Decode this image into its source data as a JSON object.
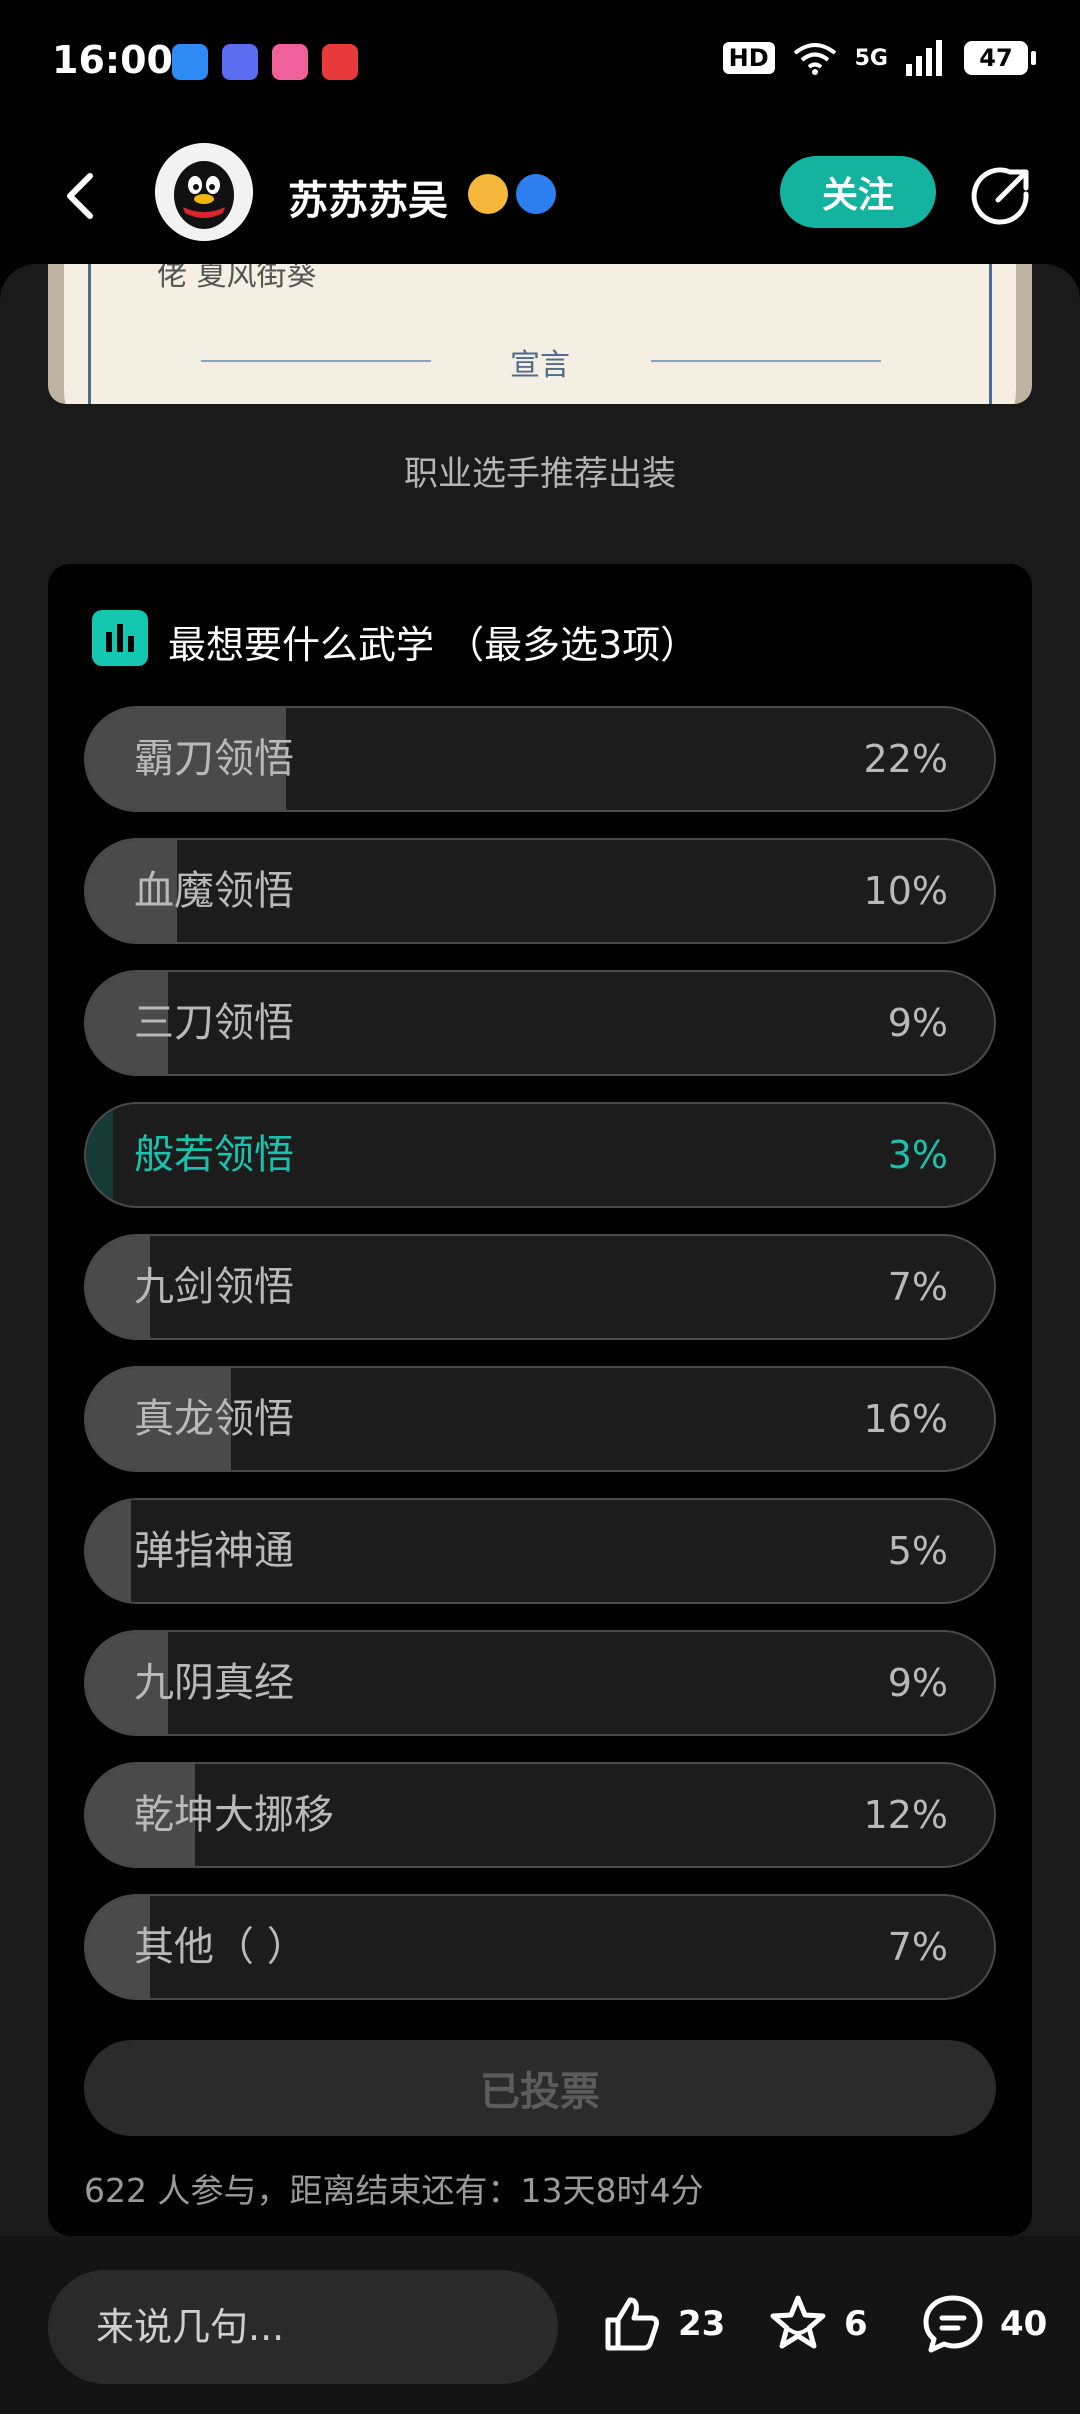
{
  "status_bar": {
    "time": "16:00",
    "hd_label": "HD",
    "network": "5G",
    "battery": "47",
    "app_icons": [
      "blue-app-icon",
      "tieba-icon",
      "bilibili-icon",
      "toutiao-icon"
    ]
  },
  "header": {
    "author_name": "苏苏苏吴",
    "follow_label": "关注"
  },
  "post": {
    "image_top_text": "佬  夏风街葵",
    "image_title": "宣言",
    "caption": "职业选手推荐出装"
  },
  "poll": {
    "title": "最想要什么武学 （最多选3项）",
    "options": [
      {
        "label": "霸刀领悟",
        "percent": "22%",
        "value": 22,
        "selected": false
      },
      {
        "label": "血魔领悟",
        "percent": "10%",
        "value": 10,
        "selected": false
      },
      {
        "label": "三刀领悟",
        "percent": "9%",
        "value": 9,
        "selected": false
      },
      {
        "label": "般若领悟",
        "percent": "3%",
        "value": 3,
        "selected": true
      },
      {
        "label": "九剑领悟",
        "percent": "7%",
        "value": 7,
        "selected": false
      },
      {
        "label": "真龙领悟",
        "percent": "16%",
        "value": 16,
        "selected": false
      },
      {
        "label": "弹指神通",
        "percent": "5%",
        "value": 5,
        "selected": false
      },
      {
        "label": "九阴真经",
        "percent": "9%",
        "value": 9,
        "selected": false
      },
      {
        "label": "乾坤大挪移",
        "percent": "12%",
        "value": 12,
        "selected": false
      },
      {
        "label": "其他（ ）",
        "percent": "7%",
        "value": 7,
        "selected": false
      }
    ],
    "voted_label": "已投票",
    "footer": "622 人参与，距离结束还有：13天8时4分"
  },
  "bottom_bar": {
    "comment_placeholder": "来说几句...",
    "likes": "23",
    "favorites": "6",
    "comments": "40"
  },
  "colors": {
    "accent": "#14b3a0",
    "selected_text": "#19c2ac",
    "background": "#000000",
    "card": "#1a1a1a"
  }
}
